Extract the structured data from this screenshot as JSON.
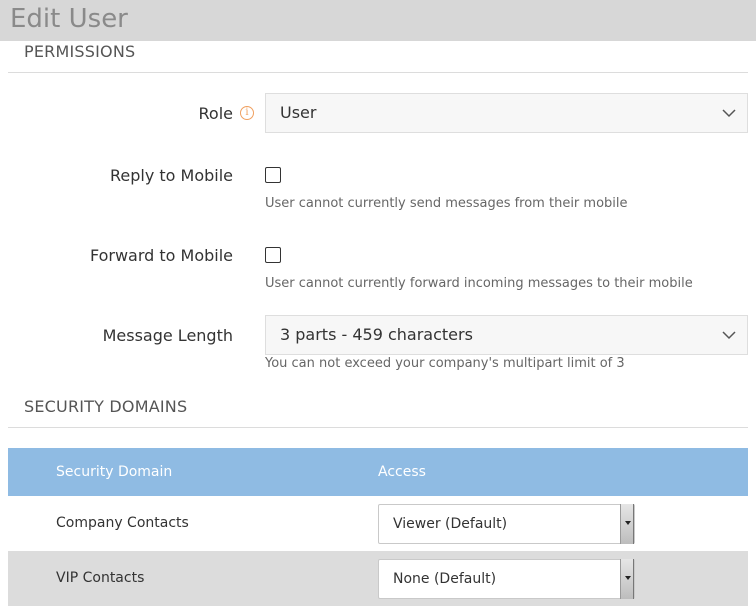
{
  "header": {
    "title": "Edit User"
  },
  "permissions": {
    "section_title": "PERMISSIONS",
    "role": {
      "label": "Role",
      "value": "User"
    },
    "reply_to_mobile": {
      "label": "Reply to Mobile",
      "checked": false,
      "help": "User cannot currently send messages from their mobile"
    },
    "forward_to_mobile": {
      "label": "Forward to Mobile",
      "checked": false,
      "help": "User cannot currently forward incoming messages to their mobile"
    },
    "message_length": {
      "label": "Message Length",
      "value": "3 parts - 459 characters",
      "help": "You can not exceed your company's multipart limit of 3"
    }
  },
  "security_domains": {
    "section_title": "SECURITY DOMAINS",
    "columns": [
      "Security Domain",
      "Access"
    ],
    "rows": [
      {
        "name": "Company Contacts",
        "access": "Viewer (Default)"
      },
      {
        "name": "VIP Contacts",
        "access": "None (Default)"
      }
    ]
  },
  "colors": {
    "table_header": "#8fbbe3",
    "title_bar": "#d7d7d7",
    "info_icon": "#f0a060"
  }
}
